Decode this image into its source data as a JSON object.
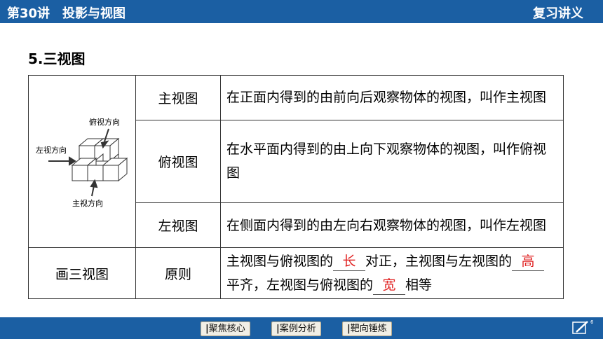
{
  "header": {
    "lecture": "第30讲　投影与视图",
    "notes_label": "复习讲义"
  },
  "section_title": "5.三视图",
  "figure_labels": {
    "top_dir": "俯视方向",
    "left_dir": "左视方向",
    "front_dir": "主视方向"
  },
  "rows": [
    {
      "name": "主视图",
      "desc": "在正面内得到的由前向后观察物体的视图，叫作主视图"
    },
    {
      "name": "俯视图",
      "desc": "在水平面内得到的由上向下观察物体的视图，叫作俯视图"
    },
    {
      "name": "左视图",
      "desc": "在侧面内得到的由左向右观察物体的视图，叫作左视图"
    }
  ],
  "draw_row": {
    "label": "画三视图",
    "name": "原则",
    "parts": [
      "主视图与俯视图的",
      "对正，主视图与左视图的",
      "平齐，左视图与俯视图的",
      "相等"
    ],
    "answers": [
      "长",
      "高",
      "宽"
    ]
  },
  "nav": {
    "buttons": [
      "聚焦核心",
      "案例分析",
      "靶向锤炼"
    ]
  },
  "page_number": "6",
  "colors": {
    "bar": "#1b5fa3",
    "answer": "#e02020"
  }
}
